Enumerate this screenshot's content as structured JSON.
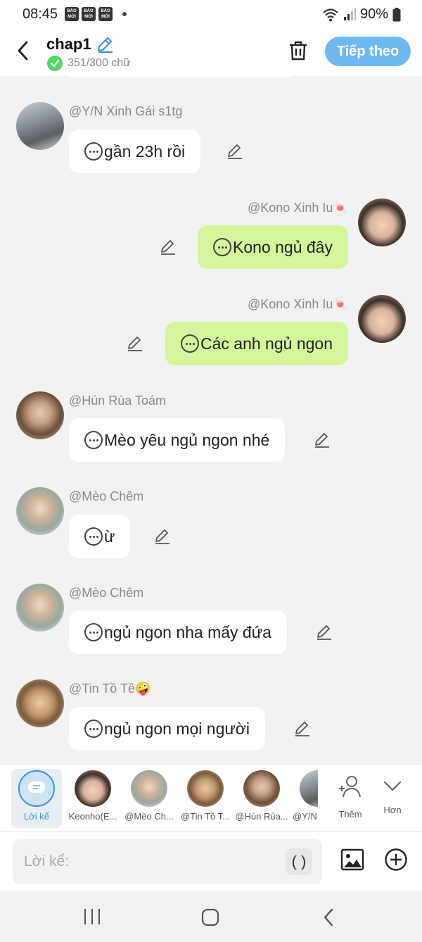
{
  "status_bar": {
    "time": "08:45",
    "badges": [
      "BÁO MỚI",
      "BÁO MỚI",
      "BÁO MỚI"
    ],
    "battery": "90%"
  },
  "header": {
    "title": "chap1",
    "word_count": "351/300 chữ",
    "next_label": "Tiếp theo"
  },
  "messages": [
    {
      "username": "@Y/N Xinh Gái s1tg",
      "text": "gần 23h rồi",
      "side": "left"
    },
    {
      "username": "@Kono Xinh Iu🍬",
      "text": "Kono ngủ đây",
      "side": "right"
    },
    {
      "username": "@Kono Xinh Iu🍬",
      "text": "Các anh ngủ ngon",
      "side": "right"
    },
    {
      "username": "@Hún Rùa Toám",
      "text": "Mèo yêu ngủ ngon nhé",
      "side": "left"
    },
    {
      "username": "@Mèo Chêm",
      "text": "ừ",
      "side": "left"
    },
    {
      "username": "@Mèo Chêm",
      "text": "ngủ ngon nha mấy đứa",
      "side": "left"
    },
    {
      "username": "@Tin Tồ Tề🤪",
      "text": "ngủ ngon mọi người",
      "side": "left"
    }
  ],
  "characters": [
    {
      "label": "Lời kể"
    },
    {
      "label": "Keonho(E..."
    },
    {
      "label": "@Mèo Ch..."
    },
    {
      "label": "@Tin Tồ T..."
    },
    {
      "label": "@Hún Rùa..."
    },
    {
      "label": "@Y/N"
    }
  ],
  "char_actions": {
    "add_label": "Thêm",
    "more_label": "Hơn"
  },
  "input": {
    "placeholder": "Lời kể:",
    "paren_label": "( )"
  },
  "colors": {
    "accent": "#6fb9f2",
    "right_bubble": "#d6f59b",
    "left_bubble": "#ffffff",
    "check": "#4cd964"
  }
}
